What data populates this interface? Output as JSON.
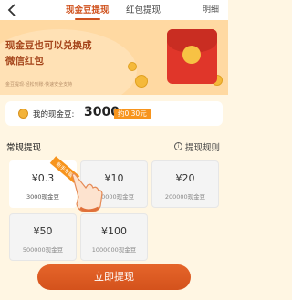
{
  "header": {
    "tabs": [
      {
        "label": "现金豆提现",
        "active": true
      },
      {
        "label": "红包提现",
        "active": false
      }
    ],
    "detail_label": "明细"
  },
  "banner": {
    "line1": "现金豆也可以兑换成",
    "line2": "微信红包",
    "subtext": "金豆提现·轻松到账·快速安全支持"
  },
  "balance": {
    "label": "我的现金豆:",
    "value": "3000",
    "badge": "约0.30元"
  },
  "section": {
    "title": "常规提现",
    "rules_label": "提现规则"
  },
  "options": [
    {
      "amount": "¥0.3",
      "beans": "3000现金豆",
      "badge": "新手专属",
      "selected": true
    },
    {
      "amount": "¥10",
      "beans": "100000现金豆",
      "selected": false
    },
    {
      "amount": "¥20",
      "beans": "200000现金豆",
      "selected": false
    },
    {
      "amount": "¥50",
      "beans": "500000现金豆",
      "selected": false
    },
    {
      "amount": "¥100",
      "beans": "1000000现金豆",
      "selected": false
    }
  ],
  "withdraw_button": "立即提现",
  "colors": {
    "accent": "#d0531f",
    "badge": "#f7941d",
    "banner_bg": "#ffd9a2",
    "page_bg": "#fff6e3"
  }
}
